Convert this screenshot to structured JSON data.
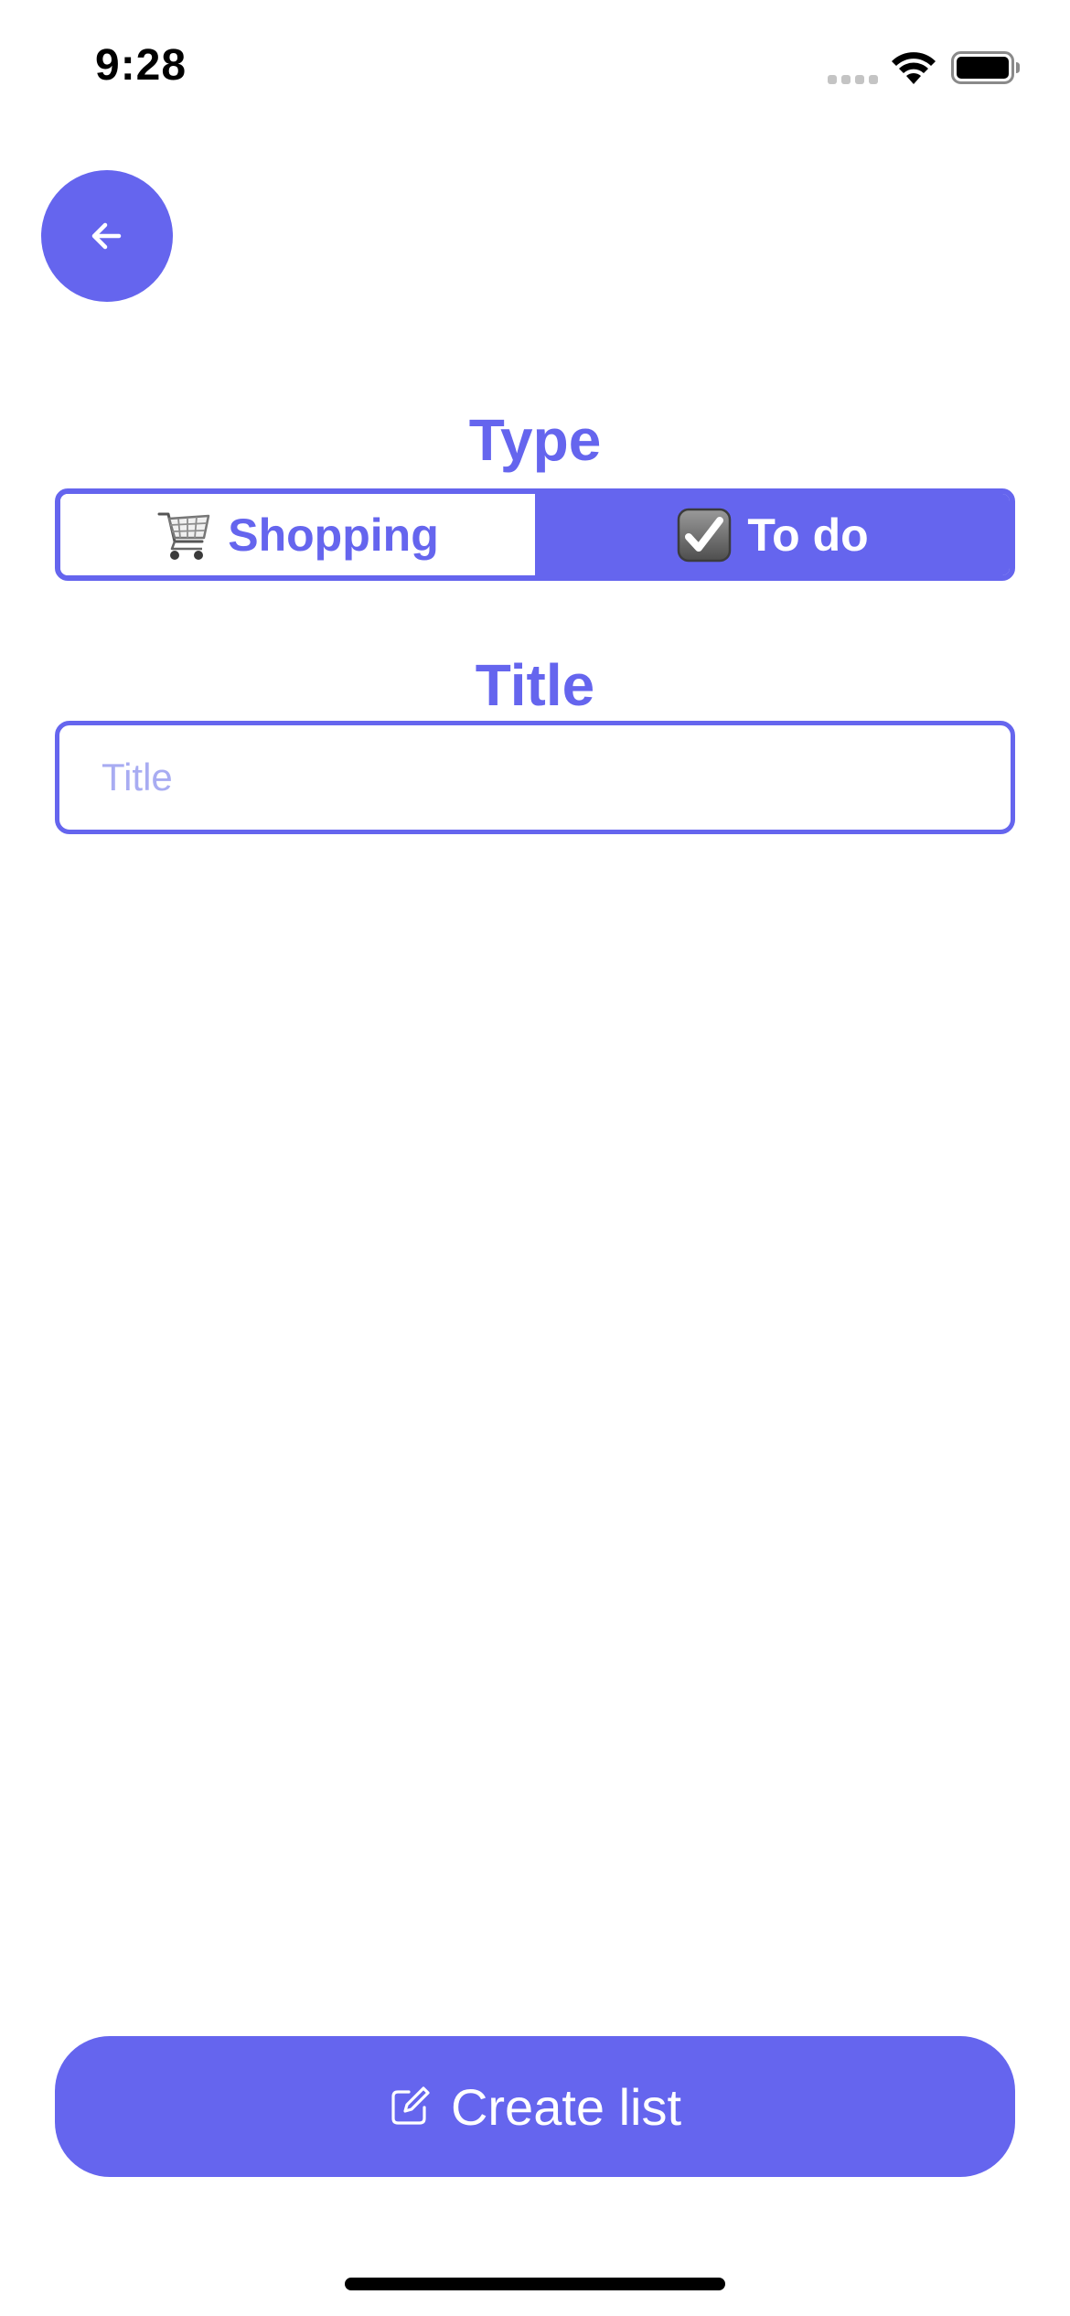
{
  "status_bar": {
    "time": "9:28",
    "icons": [
      "cellular-signal-icon",
      "wifi-icon",
      "battery-icon"
    ]
  },
  "header": {
    "back_icon": "arrow-left-icon"
  },
  "type_section": {
    "heading": "Type",
    "options": [
      {
        "icon": "shopping-cart-icon",
        "label": "Shopping",
        "selected": false
      },
      {
        "icon": "checkbox-checked-icon",
        "label": "To do",
        "selected": true
      }
    ]
  },
  "title_section": {
    "heading": "Title",
    "input_value": "",
    "input_placeholder": "Title"
  },
  "footer": {
    "create_icon": "compose-icon",
    "create_label": "Create list"
  },
  "colors": {
    "accent": "#6565ee",
    "placeholder": "#a8acf2",
    "background": "#ffffff"
  }
}
